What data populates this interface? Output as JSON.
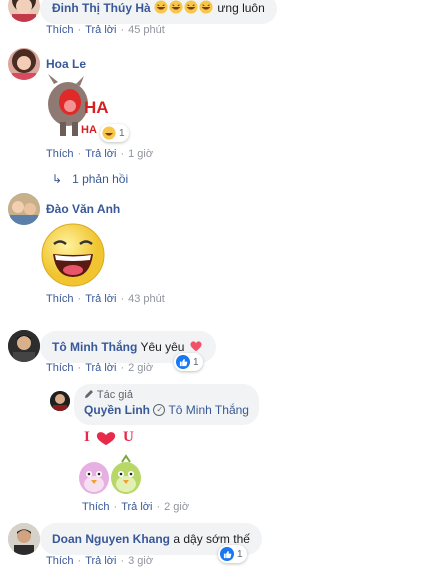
{
  "comments": [
    {
      "name": "Đinh Thị Thúy Hà",
      "text_suffix": "ưng luôn",
      "like": "Thích",
      "reply": "Trả lời",
      "time": "45 phút"
    },
    {
      "name": "Hoa Le",
      "sticker_text_1": "HA",
      "sticker_text_2": "HA",
      "reaction_count": "1",
      "like": "Thích",
      "reply": "Trả lời",
      "time": "1 giờ",
      "replies_label": "1 phản hồi"
    },
    {
      "name": "Đào Văn Anh",
      "like": "Thích",
      "reply": "Trả lời",
      "time": "43 phút"
    },
    {
      "name": "Tô Minh Thắng",
      "text": "Yêu yêu",
      "reaction_count": "1",
      "like": "Thích",
      "reply": "Trả lời",
      "time": "2 giờ"
    },
    {
      "author_tag": "Tác giả",
      "name": "Quyền Linh",
      "mention": "Tô Minh Thắng",
      "sticker_text": "I",
      "sticker_text_2": "U",
      "like": "Thích",
      "reply": "Trả lời",
      "time": "2 giờ"
    },
    {
      "name": "Doan Nguyen Khang",
      "text": "a dậy sớm thế",
      "reaction_count": "1",
      "like": "Thích",
      "reply": "Trả lời",
      "time": "3 giờ"
    }
  ],
  "colors": {
    "link": "#385898",
    "bubble": "#f2f3f5",
    "like_blue": "#1877f2",
    "heart": "#f25268"
  }
}
